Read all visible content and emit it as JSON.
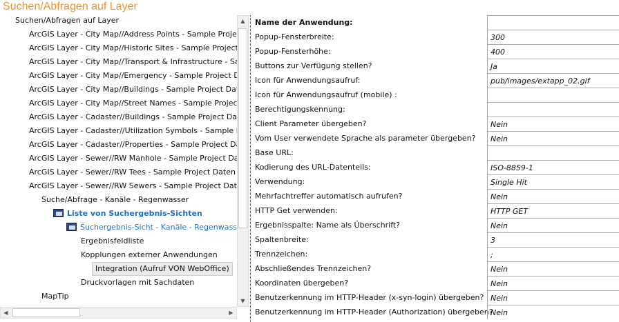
{
  "title": "Suchen/Abfragen auf Layer",
  "tree": [
    {
      "label": "Suchen/Abfragen auf Layer"
    },
    {
      "label": "ArcGIS Layer - City Map//Address Points - Sample Project D"
    },
    {
      "label": "ArcGIS Layer - City Map//Historic Sites - Sample Project Dat"
    },
    {
      "label": "ArcGIS Layer - City Map//Transport & Infrastructure - Sampl"
    },
    {
      "label": "ArcGIS Layer - City Map//Emergency - Sample Project Date"
    },
    {
      "label": "ArcGIS Layer - City Map//Buildings - Sample Project Daten -"
    },
    {
      "label": "ArcGIS Layer - City Map//Street Names - Sample Project Da"
    },
    {
      "label": "ArcGIS Layer - Cadaster//Buildings - Sample Project Daten -"
    },
    {
      "label": "ArcGIS Layer - Cadaster//Utilization Symbols - Sample Proje"
    },
    {
      "label": "ArcGIS Layer - Cadaster//Properties - Sample Project Daten"
    },
    {
      "label": "ArcGIS Layer - Sewer//RW Manhole - Sample Project Daten"
    },
    {
      "label": "ArcGIS Layer - Sewer//RW Tees - Sample Project Daten - htt"
    },
    {
      "label": "ArcGIS Layer - Sewer//RW Sewers - Sample Project Daten -"
    },
    {
      "label": "Suche/Abfrage - Kanäle - Regenwasser"
    },
    {
      "label": "Liste von Suchergebnis-Sichten"
    },
    {
      "label": "Suchergebnis-Sicht - Kanäle - Regenwasser"
    },
    {
      "label": "Ergebnisfeldliste"
    },
    {
      "label": "Kopplungen externer Anwendungen"
    },
    {
      "label": "Integration (Aufruf VON WebOffice)"
    },
    {
      "label": "Druckvorlagen mit Sachdaten"
    },
    {
      "label": "MapTip"
    }
  ],
  "properties": [
    {
      "label": "Name der Anwendung:",
      "value": ""
    },
    {
      "label": "Popup-Fensterbreite:",
      "value": "300"
    },
    {
      "label": "Popup-Fensterhöhe:",
      "value": "400"
    },
    {
      "label": "Buttons zur Verfügung stellen?",
      "value": "Ja"
    },
    {
      "label": "Icon für Anwendungsaufruf:",
      "value": "pub/images/extapp_02.gif"
    },
    {
      "label": "Icon für Anwendungsaufruf (mobile) :",
      "value": ""
    },
    {
      "label": "Berechtigungskennung:",
      "value": ""
    },
    {
      "label": "Client Parameter übergeben?",
      "value": "Nein"
    },
    {
      "label": "Vom User verwendete Sprache als parameter übergeben?",
      "value": "Nein"
    },
    {
      "label": "Base URL:",
      "value": ""
    },
    {
      "label": "Kodierung des URL-Datenteils:",
      "value": "ISO-8859-1"
    },
    {
      "label": "Verwendung:",
      "value": "Single Hit"
    },
    {
      "label": "Mehrfachtreffer automatisch aufrufen?",
      "value": "Nein"
    },
    {
      "label": "HTTP Get verwenden:",
      "value": "HTTP GET"
    },
    {
      "label": "Ergebnisspalte: Name als Überschrift?",
      "value": "Nein"
    },
    {
      "label": "Spaltenbreite:",
      "value": "3"
    },
    {
      "label": "Trennzeichen:",
      "value": ";"
    },
    {
      "label": "Abschließendes Trennzeichen?",
      "value": "Nein"
    },
    {
      "label": "Koordinaten übergeben?",
      "value": "Nein"
    },
    {
      "label": "Benutzerkennung im HTTP-Header (x-syn-login) übergeben?",
      "value": "Nein"
    },
    {
      "label": "Benutzerkennung im HTTP-Header (Authorization) übergeben?",
      "value": "Nein"
    }
  ]
}
